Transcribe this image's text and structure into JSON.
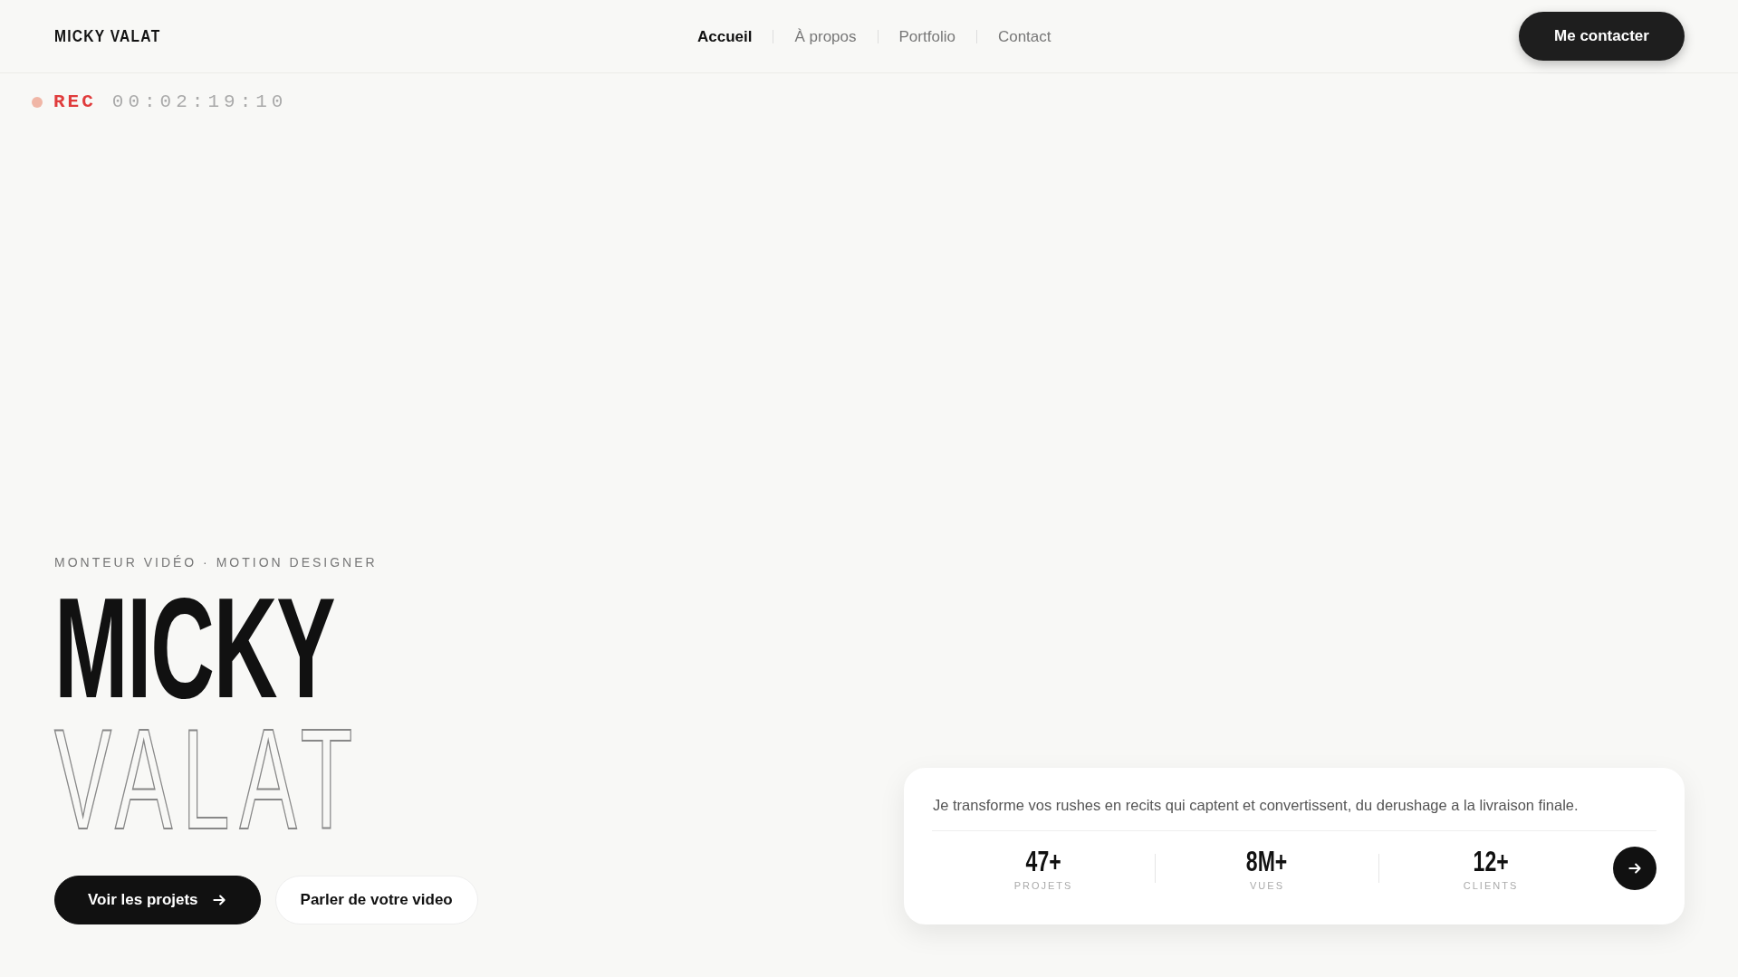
{
  "header": {
    "logo": "MICKY VALAT",
    "nav": [
      {
        "label": "Accueil",
        "selected": true
      },
      {
        "label": "À propos",
        "selected": false
      },
      {
        "label": "Portfolio",
        "selected": false
      },
      {
        "label": "Contact",
        "selected": false
      }
    ],
    "cta": "Me contacter"
  },
  "recorder": {
    "label": "REC",
    "timecode": "00:02:19:10"
  },
  "hero": {
    "subtitle": "MONTEUR VIDÉO · MOTION DESIGNER",
    "first_name": "MICKY",
    "last_name": "VALAT",
    "buttons": [
      {
        "label": "Voir les projets",
        "kind": "primary"
      },
      {
        "label": "Parler de votre video",
        "kind": "secondary"
      }
    ]
  },
  "card": {
    "text": "Je transforme vos rushes en recits qui captent et convertissent, du derushage a la livraison finale.",
    "stats": [
      {
        "value": "47+",
        "label": "PROJETS"
      },
      {
        "value": "8M+",
        "label": "VUES"
      },
      {
        "value": "12+",
        "label": "CLIENTS"
      }
    ]
  }
}
